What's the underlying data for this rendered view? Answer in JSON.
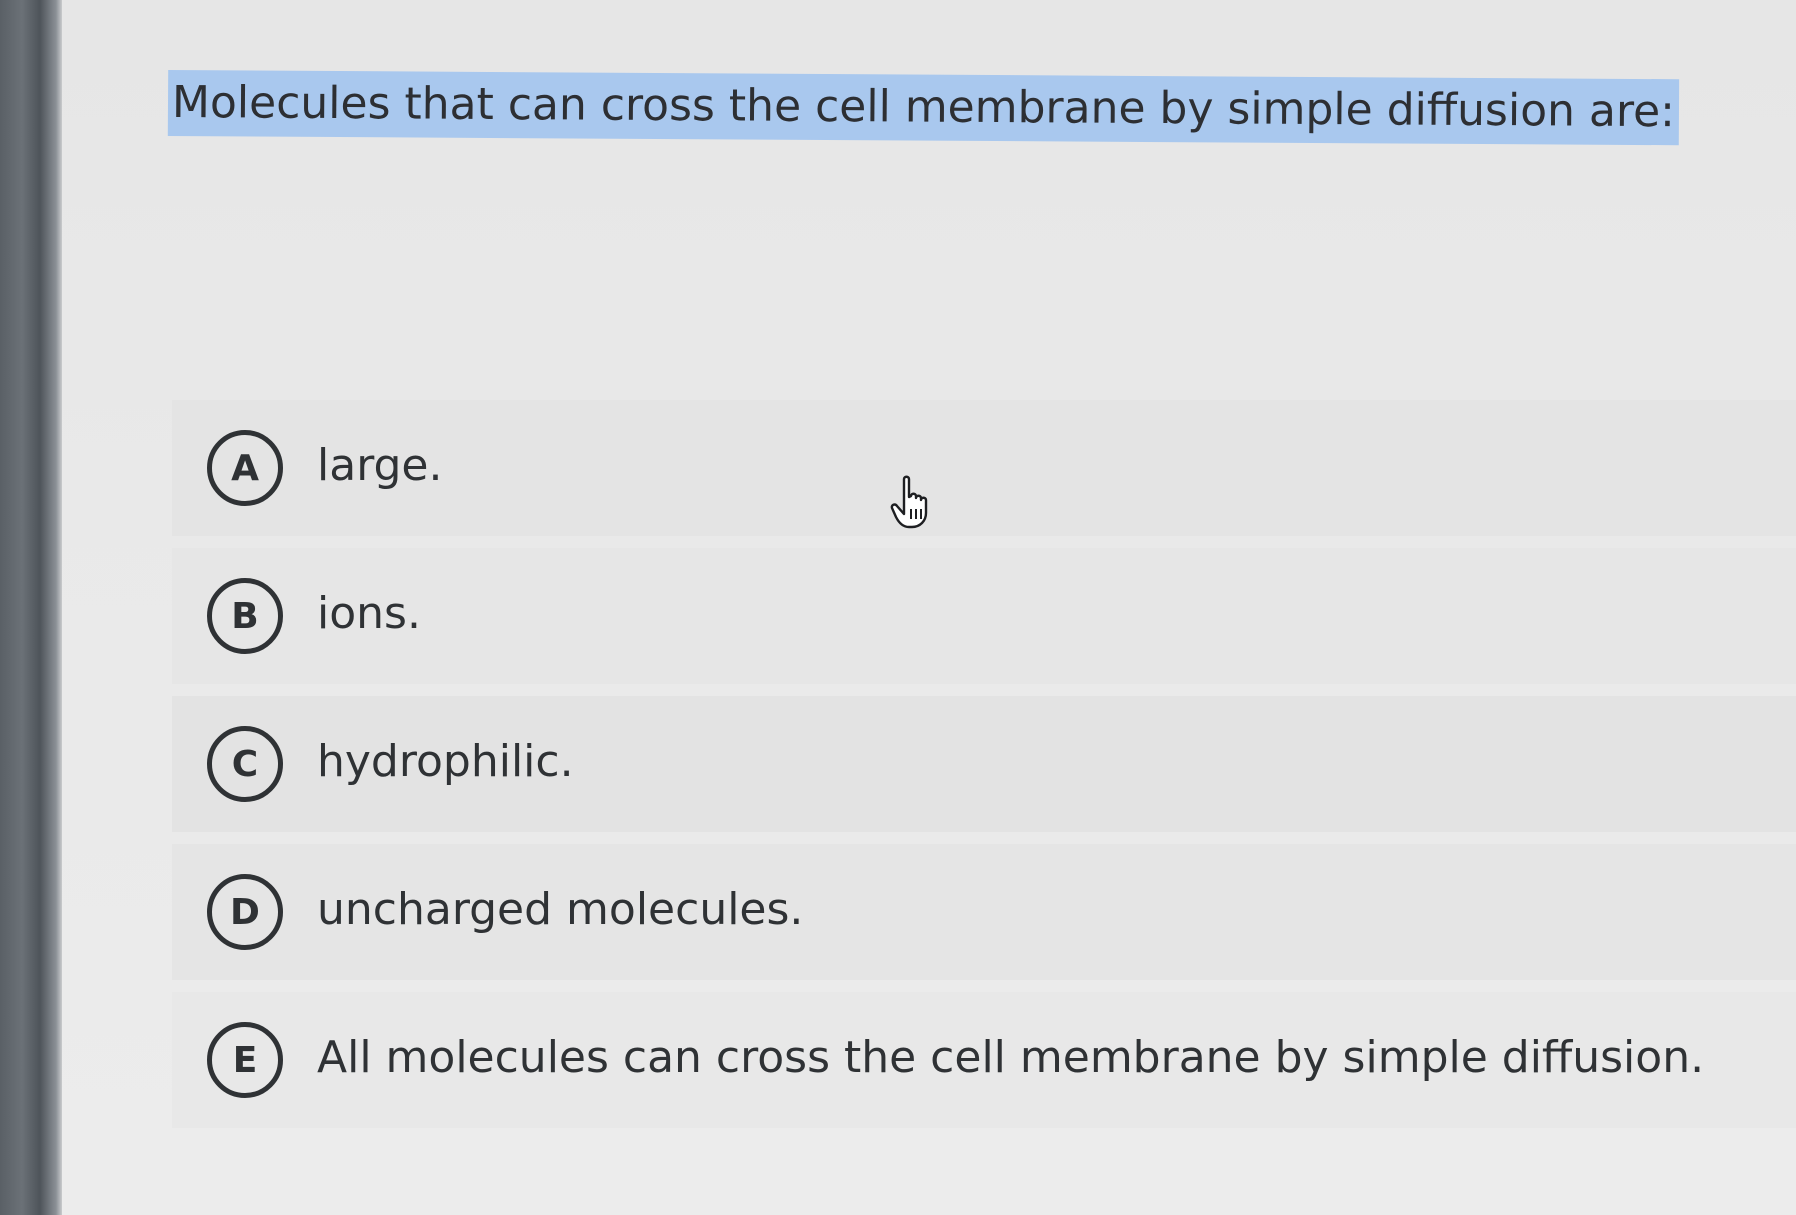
{
  "question": {
    "text": "Molecules that can cross the cell membrane by simple diffusion are:"
  },
  "options": [
    {
      "letter": "A",
      "text": "large."
    },
    {
      "letter": "B",
      "text": "ions."
    },
    {
      "letter": "C",
      "text": "hydrophilic."
    },
    {
      "letter": "D",
      "text": "uncharged molecules."
    },
    {
      "letter": "E",
      "text": "All molecules can cross the cell membrane by simple diffusion."
    }
  ],
  "colors": {
    "highlight": "#a9c8ee",
    "text": "#2f3235",
    "option_background": "#e4e4e4"
  },
  "icons": {
    "cursor": "hand-pointer-icon"
  }
}
